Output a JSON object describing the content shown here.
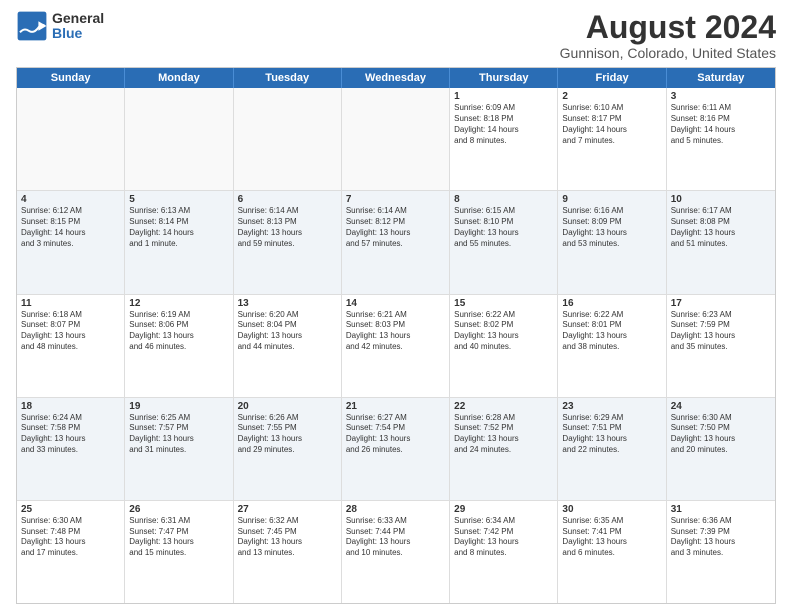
{
  "header": {
    "logo_general": "General",
    "logo_blue": "Blue",
    "main_title": "August 2024",
    "subtitle": "Gunnison, Colorado, United States"
  },
  "calendar": {
    "days_of_week": [
      "Sunday",
      "Monday",
      "Tuesday",
      "Wednesday",
      "Thursday",
      "Friday",
      "Saturday"
    ],
    "weeks": [
      [
        {
          "day": "",
          "text": ""
        },
        {
          "day": "",
          "text": ""
        },
        {
          "day": "",
          "text": ""
        },
        {
          "day": "",
          "text": ""
        },
        {
          "day": "1",
          "text": "Sunrise: 6:09 AM\nSunset: 8:18 PM\nDaylight: 14 hours\nand 8 minutes."
        },
        {
          "day": "2",
          "text": "Sunrise: 6:10 AM\nSunset: 8:17 PM\nDaylight: 14 hours\nand 7 minutes."
        },
        {
          "day": "3",
          "text": "Sunrise: 6:11 AM\nSunset: 8:16 PM\nDaylight: 14 hours\nand 5 minutes."
        }
      ],
      [
        {
          "day": "4",
          "text": "Sunrise: 6:12 AM\nSunset: 8:15 PM\nDaylight: 14 hours\nand 3 minutes."
        },
        {
          "day": "5",
          "text": "Sunrise: 6:13 AM\nSunset: 8:14 PM\nDaylight: 14 hours\nand 1 minute."
        },
        {
          "day": "6",
          "text": "Sunrise: 6:14 AM\nSunset: 8:13 PM\nDaylight: 13 hours\nand 59 minutes."
        },
        {
          "day": "7",
          "text": "Sunrise: 6:14 AM\nSunset: 8:12 PM\nDaylight: 13 hours\nand 57 minutes."
        },
        {
          "day": "8",
          "text": "Sunrise: 6:15 AM\nSunset: 8:10 PM\nDaylight: 13 hours\nand 55 minutes."
        },
        {
          "day": "9",
          "text": "Sunrise: 6:16 AM\nSunset: 8:09 PM\nDaylight: 13 hours\nand 53 minutes."
        },
        {
          "day": "10",
          "text": "Sunrise: 6:17 AM\nSunset: 8:08 PM\nDaylight: 13 hours\nand 51 minutes."
        }
      ],
      [
        {
          "day": "11",
          "text": "Sunrise: 6:18 AM\nSunset: 8:07 PM\nDaylight: 13 hours\nand 48 minutes."
        },
        {
          "day": "12",
          "text": "Sunrise: 6:19 AM\nSunset: 8:06 PM\nDaylight: 13 hours\nand 46 minutes."
        },
        {
          "day": "13",
          "text": "Sunrise: 6:20 AM\nSunset: 8:04 PM\nDaylight: 13 hours\nand 44 minutes."
        },
        {
          "day": "14",
          "text": "Sunrise: 6:21 AM\nSunset: 8:03 PM\nDaylight: 13 hours\nand 42 minutes."
        },
        {
          "day": "15",
          "text": "Sunrise: 6:22 AM\nSunset: 8:02 PM\nDaylight: 13 hours\nand 40 minutes."
        },
        {
          "day": "16",
          "text": "Sunrise: 6:22 AM\nSunset: 8:01 PM\nDaylight: 13 hours\nand 38 minutes."
        },
        {
          "day": "17",
          "text": "Sunrise: 6:23 AM\nSunset: 7:59 PM\nDaylight: 13 hours\nand 35 minutes."
        }
      ],
      [
        {
          "day": "18",
          "text": "Sunrise: 6:24 AM\nSunset: 7:58 PM\nDaylight: 13 hours\nand 33 minutes."
        },
        {
          "day": "19",
          "text": "Sunrise: 6:25 AM\nSunset: 7:57 PM\nDaylight: 13 hours\nand 31 minutes."
        },
        {
          "day": "20",
          "text": "Sunrise: 6:26 AM\nSunset: 7:55 PM\nDaylight: 13 hours\nand 29 minutes."
        },
        {
          "day": "21",
          "text": "Sunrise: 6:27 AM\nSunset: 7:54 PM\nDaylight: 13 hours\nand 26 minutes."
        },
        {
          "day": "22",
          "text": "Sunrise: 6:28 AM\nSunset: 7:52 PM\nDaylight: 13 hours\nand 24 minutes."
        },
        {
          "day": "23",
          "text": "Sunrise: 6:29 AM\nSunset: 7:51 PM\nDaylight: 13 hours\nand 22 minutes."
        },
        {
          "day": "24",
          "text": "Sunrise: 6:30 AM\nSunset: 7:50 PM\nDaylight: 13 hours\nand 20 minutes."
        }
      ],
      [
        {
          "day": "25",
          "text": "Sunrise: 6:30 AM\nSunset: 7:48 PM\nDaylight: 13 hours\nand 17 minutes."
        },
        {
          "day": "26",
          "text": "Sunrise: 6:31 AM\nSunset: 7:47 PM\nDaylight: 13 hours\nand 15 minutes."
        },
        {
          "day": "27",
          "text": "Sunrise: 6:32 AM\nSunset: 7:45 PM\nDaylight: 13 hours\nand 13 minutes."
        },
        {
          "day": "28",
          "text": "Sunrise: 6:33 AM\nSunset: 7:44 PM\nDaylight: 13 hours\nand 10 minutes."
        },
        {
          "day": "29",
          "text": "Sunrise: 6:34 AM\nSunset: 7:42 PM\nDaylight: 13 hours\nand 8 minutes."
        },
        {
          "day": "30",
          "text": "Sunrise: 6:35 AM\nSunset: 7:41 PM\nDaylight: 13 hours\nand 6 minutes."
        },
        {
          "day": "31",
          "text": "Sunrise: 6:36 AM\nSunset: 7:39 PM\nDaylight: 13 hours\nand 3 minutes."
        }
      ]
    ]
  }
}
